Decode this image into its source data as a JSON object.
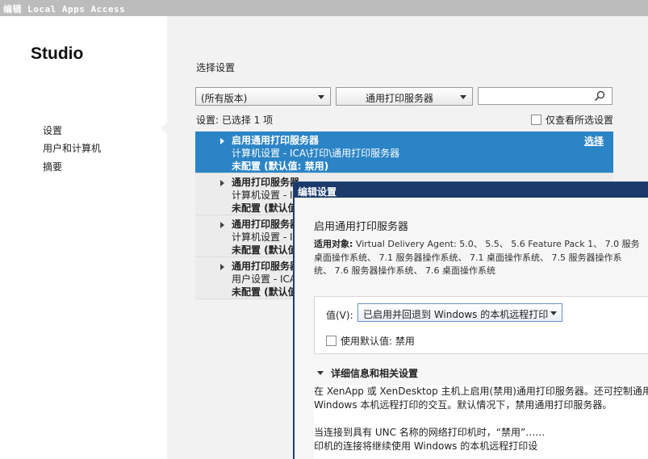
{
  "window": {
    "title": "编辑 Local Apps Access"
  },
  "app": {
    "name": "Studio"
  },
  "sidebar": {
    "items": [
      {
        "label": "设置"
      },
      {
        "label": "用户和计算机"
      },
      {
        "label": "摘要"
      }
    ]
  },
  "main": {
    "section_title": "选择设置",
    "version_filter": "(所有版本)",
    "category_filter": "通用打印服务器",
    "search": {
      "placeholder": "",
      "value": ""
    },
    "settings_count": "设置: 已选择 1 项",
    "show_selected_only": "仅查看所选设置",
    "policies": [
      {
        "name": "启用通用打印服务器",
        "path": "计算机设置 - ICA\\打印\\通用打印服务器",
        "state": "未配置 (默认值: 禁用)",
        "action": "选择"
      },
      {
        "name": "通用打印服务器",
        "path": "计算机设置 - I",
        "state": "未配置 (默认值"
      },
      {
        "name": "通用打印服务器",
        "path": "计算机设置 - I",
        "state": "未配置 (默认值"
      },
      {
        "name": "通用打印服务器",
        "path": "用户设置 - ICA",
        "state": "未配置 (默认值"
      }
    ]
  },
  "dialog": {
    "title": "编辑设置",
    "heading": "启用通用打印服务器",
    "applies_label": "适用对象:",
    "applies_lines": [
      "Virtual Delivery Agent: 5.0、 5.5、 5.6 Feature Pack 1、 7.0 服务",
      "桌面操作系统、 7.1 服务器操作系统、 7.1 桌面操作系统、 7.5 服务器操作系",
      "统、 7.6 服务器操作系统、 7.6 桌面操作系统"
    ],
    "value_label": "值(V):",
    "value_selected": "已启用并回退到 Windows 的本机远程打印",
    "use_default_label": "使用默认值: 禁用",
    "details_header": "详细信息和相关设置",
    "details_lines": [
      "在 XenApp 或 XenDesktop 主机上启用(禁用)通用打印服务器。还可控制通用",
      "Windows 本机远程打印的交互。默认情况下，禁用通用打印服务器。",
      "当连接到具有 UNC 名称的网络打印机时，“禁用”……",
      "印机的连接将继续使用 Windows 的本机远程打印设"
    ]
  }
}
